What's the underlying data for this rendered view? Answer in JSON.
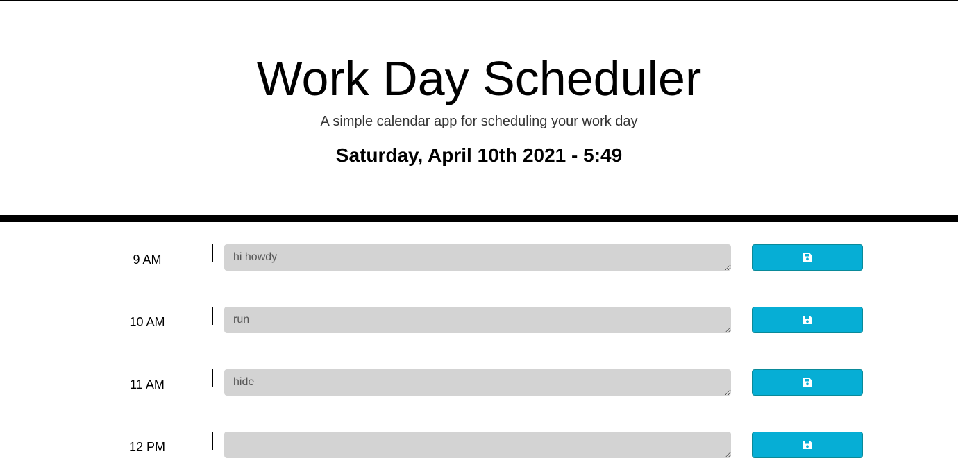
{
  "header": {
    "title": "Work Day Scheduler",
    "subtitle": "A simple calendar app for scheduling your work day",
    "current_day": "Saturday, April 10th 2021 - 5:49"
  },
  "colors": {
    "save_button": "#06aed5",
    "description_bg": "#d3d3d3",
    "divider": "#000000"
  },
  "time_blocks": [
    {
      "hour": "9 AM",
      "description": "hi howdy",
      "save_icon": "save-icon"
    },
    {
      "hour": "10 AM",
      "description": "run",
      "save_icon": "save-icon"
    },
    {
      "hour": "11 AM",
      "description": "hide",
      "save_icon": "save-icon"
    },
    {
      "hour": "12 PM",
      "description": "",
      "save_icon": "save-icon"
    }
  ]
}
